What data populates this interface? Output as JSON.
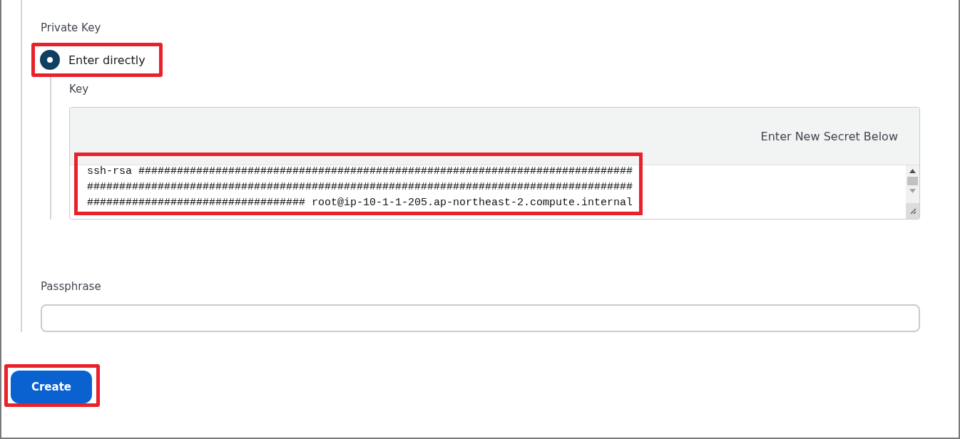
{
  "private_key": {
    "label": "Private Key",
    "options": [
      {
        "label": "Enter directly",
        "selected": true,
        "highlighted": true
      }
    ],
    "key": {
      "label": "Key",
      "header": "Enter New Secret Below",
      "value": "ssh-rsa #################################################################################################################################################################################################### root@ip-10-1-1-205.ap-northeast-2.compute.internal",
      "highlighted": true
    }
  },
  "passphrase": {
    "label": "Passphrase"
  },
  "buttons": [
    {
      "label": "Create",
      "highlighted": true
    }
  ]
}
